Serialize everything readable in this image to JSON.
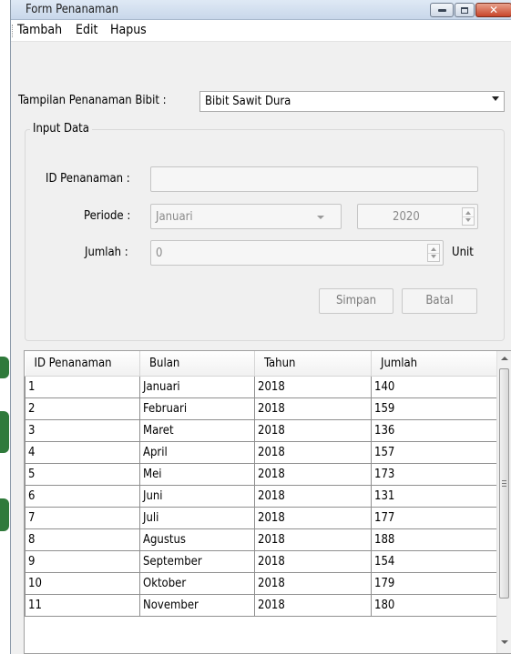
{
  "window": {
    "title": "Form Penanaman"
  },
  "menu": [
    "Tambah",
    "Edit",
    "Hapus"
  ],
  "display": {
    "label": "Tampilan Penanaman Bibit :",
    "selected": "Bibit Sawit Dura"
  },
  "input_group": {
    "title": "Input Data",
    "id_label": "ID Penanaman :",
    "id_value": "",
    "periode_label": "Periode :",
    "month_value": "Januari",
    "year_value": "2020",
    "jumlah_label": "Jumlah :",
    "jumlah_value": "0",
    "unit_label": "Unit",
    "save_label": "Simpan",
    "cancel_label": "Batal"
  },
  "table": {
    "headers": [
      "ID Penanaman",
      "Bulan",
      "Tahun",
      "Jumlah"
    ],
    "rows": [
      [
        "1",
        "Januari",
        "2018",
        "140"
      ],
      [
        "2",
        "Februari",
        "2018",
        "159"
      ],
      [
        "3",
        "Maret",
        "2018",
        "136"
      ],
      [
        "4",
        "April",
        "2018",
        "157"
      ],
      [
        "5",
        "Mei",
        "2018",
        "173"
      ],
      [
        "6",
        "Juni",
        "2018",
        "131"
      ],
      [
        "7",
        "Juli",
        "2018",
        "177"
      ],
      [
        "8",
        "Agustus",
        "2018",
        "188"
      ],
      [
        "9",
        "September",
        "2018",
        "154"
      ],
      [
        "10",
        "Oktober",
        "2018",
        "179"
      ],
      [
        "11",
        "November",
        "2018",
        "180"
      ]
    ]
  },
  "colors": {
    "title_bar": "#c8d7ea",
    "close_button": "#c8452a",
    "window_bg": "#f0f0f0"
  }
}
